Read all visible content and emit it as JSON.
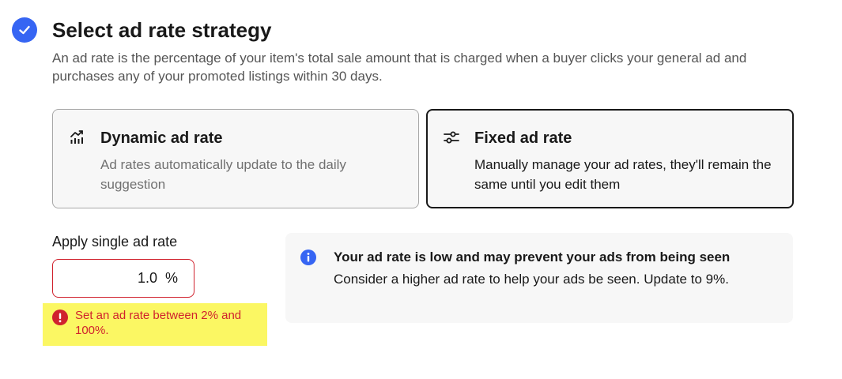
{
  "header": {
    "title": "Select ad rate strategy",
    "description": "An ad rate is the percentage of your item's total sale amount that is charged when a buyer clicks your general ad and purchases any of your promoted listings within 30 days.",
    "step_icon": "checkmark-icon"
  },
  "strategies": [
    {
      "icon": "trending-up-chart-icon",
      "title": "Dynamic ad rate",
      "description": "Ad rates automatically update to the daily suggestion",
      "selected": false
    },
    {
      "icon": "sliders-icon",
      "title": "Fixed ad rate",
      "description": "Manually manage your ad rates, they'll remain the same until you edit them",
      "selected": true
    }
  ],
  "rate": {
    "label": "Apply single ad rate",
    "value": "1.0",
    "unit": "%",
    "error_icon": "exclamation-icon",
    "error": "Set an ad rate between 2% and 100%."
  },
  "notice": {
    "icon": "info-icon",
    "title": "Your ad rate is low and may prevent your ads from being seen",
    "body": "Consider a higher ad rate to help your ads be seen. Update to 9%."
  },
  "colors": {
    "accent": "#3665f3",
    "error": "#d0222e",
    "highlight": "#fbf763",
    "notice_bg": "#f7f7f7"
  }
}
